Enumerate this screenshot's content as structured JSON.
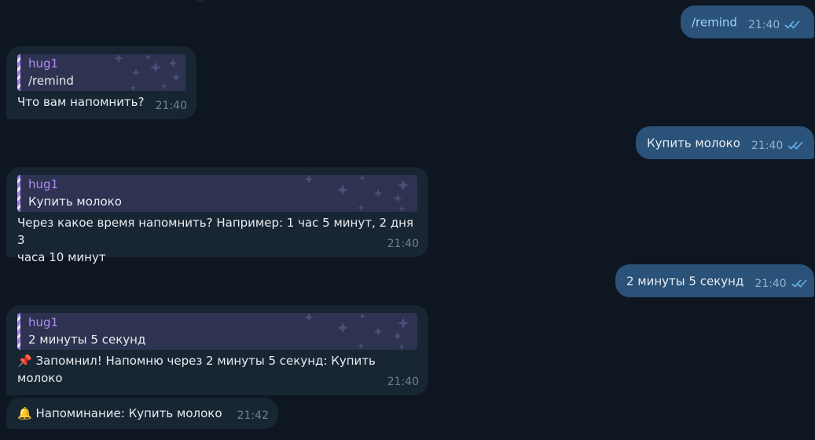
{
  "messages": {
    "out1": {
      "text": "/remind",
      "time": "21:40"
    },
    "in1": {
      "sender": "hug1",
      "quote": "/remind",
      "text": "Что вам напомнить?",
      "time": "21:40"
    },
    "out2": {
      "text": "Купить молоко",
      "time": "21:40"
    },
    "in2": {
      "sender": "hug1",
      "quote": "Купить молоко",
      "text_line1": "Через какое время напомнить? Например: 1 час 5 минут, 2 дня 3",
      "text_line2": "часа 10 минут",
      "time": "21:40"
    },
    "out3": {
      "text": "2 минуты 5 секунд",
      "time": "21:40"
    },
    "in3": {
      "sender": "hug1",
      "quote": "2 минуты 5 секунд",
      "emoji": "📌",
      "text_line1": "Запомнил! Напомню через 2 минуты 5 секунд: Купить",
      "text_line2": "молоко",
      "time": "21:40"
    },
    "in4": {
      "emoji": "🔔",
      "text": "Напоминание: Купить молоко",
      "time": "21:42"
    }
  },
  "colors": {
    "background": "#0e1621",
    "outgoing_bubble": "#2b5278",
    "incoming_bubble": "#182533",
    "quote_background": "#2d3350",
    "sender_name": "#b28cf6",
    "read_ticks": "#64b5ef"
  },
  "icons": {
    "read_ticks": "double-check-icon",
    "quote_decoration": "sparkles-icon",
    "pin": "pushpin-emoji",
    "bell": "bell-emoji"
  }
}
